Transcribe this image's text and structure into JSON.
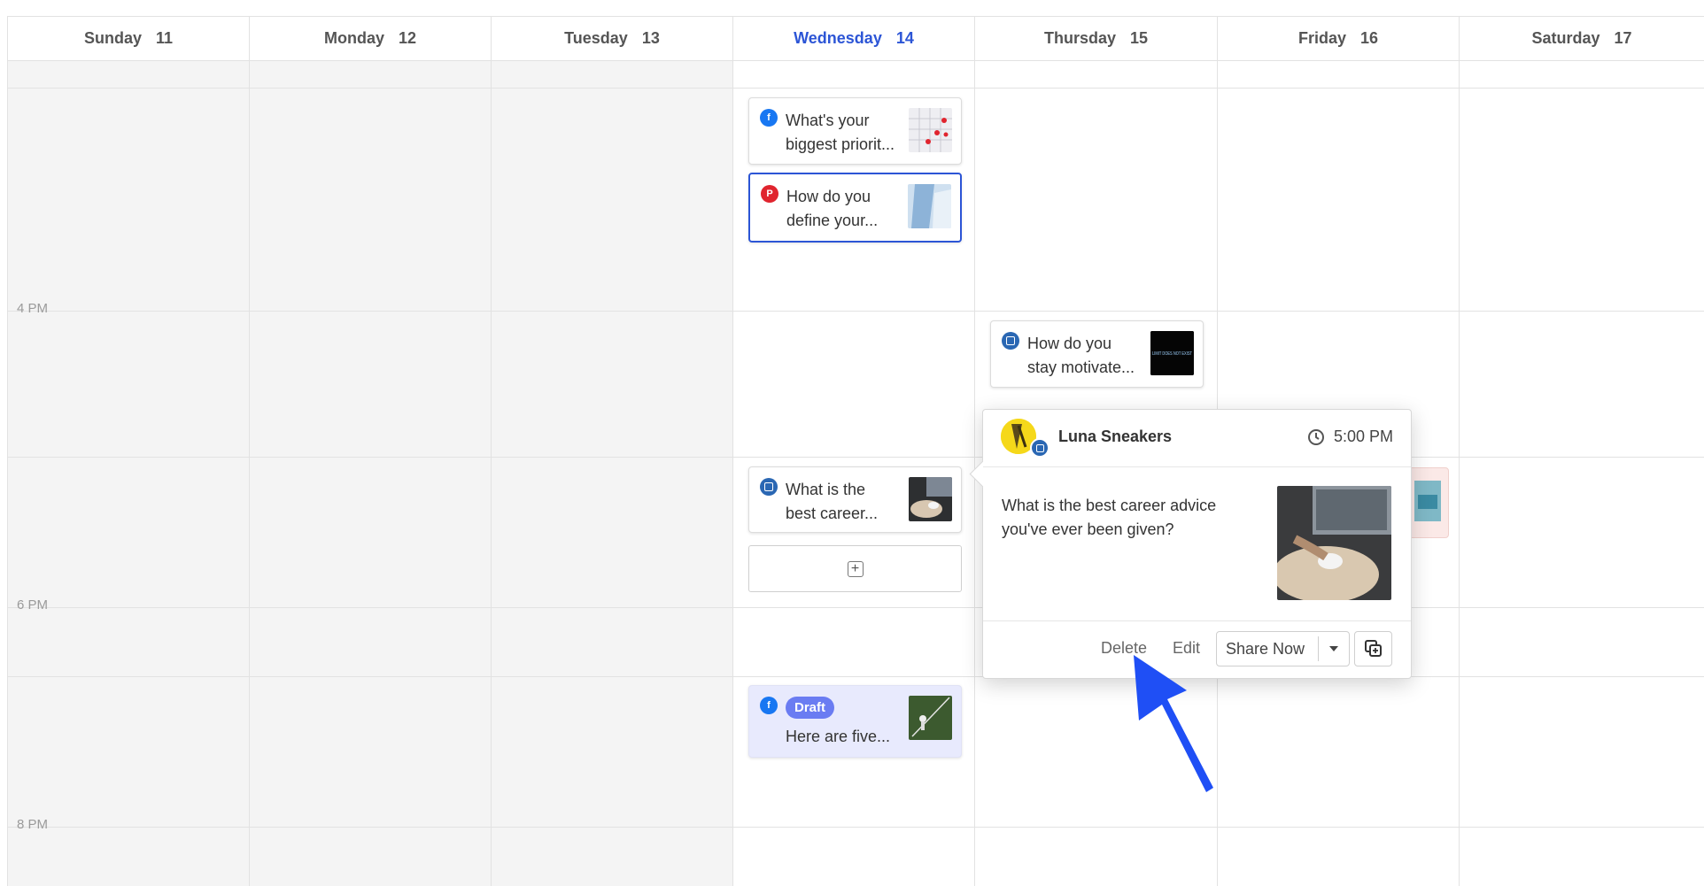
{
  "week": {
    "days": [
      {
        "name": "Sunday",
        "num": "11"
      },
      {
        "name": "Monday",
        "num": "12"
      },
      {
        "name": "Tuesday",
        "num": "13"
      },
      {
        "name": "Wednesday",
        "num": "14"
      },
      {
        "name": "Thursday",
        "num": "15"
      },
      {
        "name": "Friday",
        "num": "16"
      },
      {
        "name": "Saturday",
        "num": "17"
      }
    ],
    "today_index": 3
  },
  "time_labels": [
    "4 PM",
    "6 PM",
    "8 PM"
  ],
  "posts": [
    {
      "network": "facebook",
      "line1": "What's your",
      "line2": "biggest priorit..."
    },
    {
      "network": "pinterest",
      "line1": "How do you",
      "line2": "define your..."
    },
    {
      "network": "linkedin",
      "line1": "How do you",
      "line2": "stay motivate...",
      "thumb_text": "LIMIT DOES NOT EXIST"
    },
    {
      "network": "linkedin",
      "line1": "What is the",
      "line2": "best career..."
    },
    {
      "network": "facebook",
      "badge": "Draft",
      "line1": "Here are five..."
    }
  ],
  "popup": {
    "account_name": "Luna Sneakers",
    "time": "5:00 PM",
    "text": "What is the best career advice you've ever been given?",
    "actions": {
      "delete": "Delete",
      "edit": "Edit",
      "share_now": "Share Now"
    }
  },
  "colors": {
    "accent": "#2c55d6",
    "facebook": "#1877f2",
    "pinterest": "#e0242e",
    "linkedin": "#2a67b3",
    "draft_badge": "#6a7cf2",
    "pointer_arrow": "#1f4ff5"
  }
}
